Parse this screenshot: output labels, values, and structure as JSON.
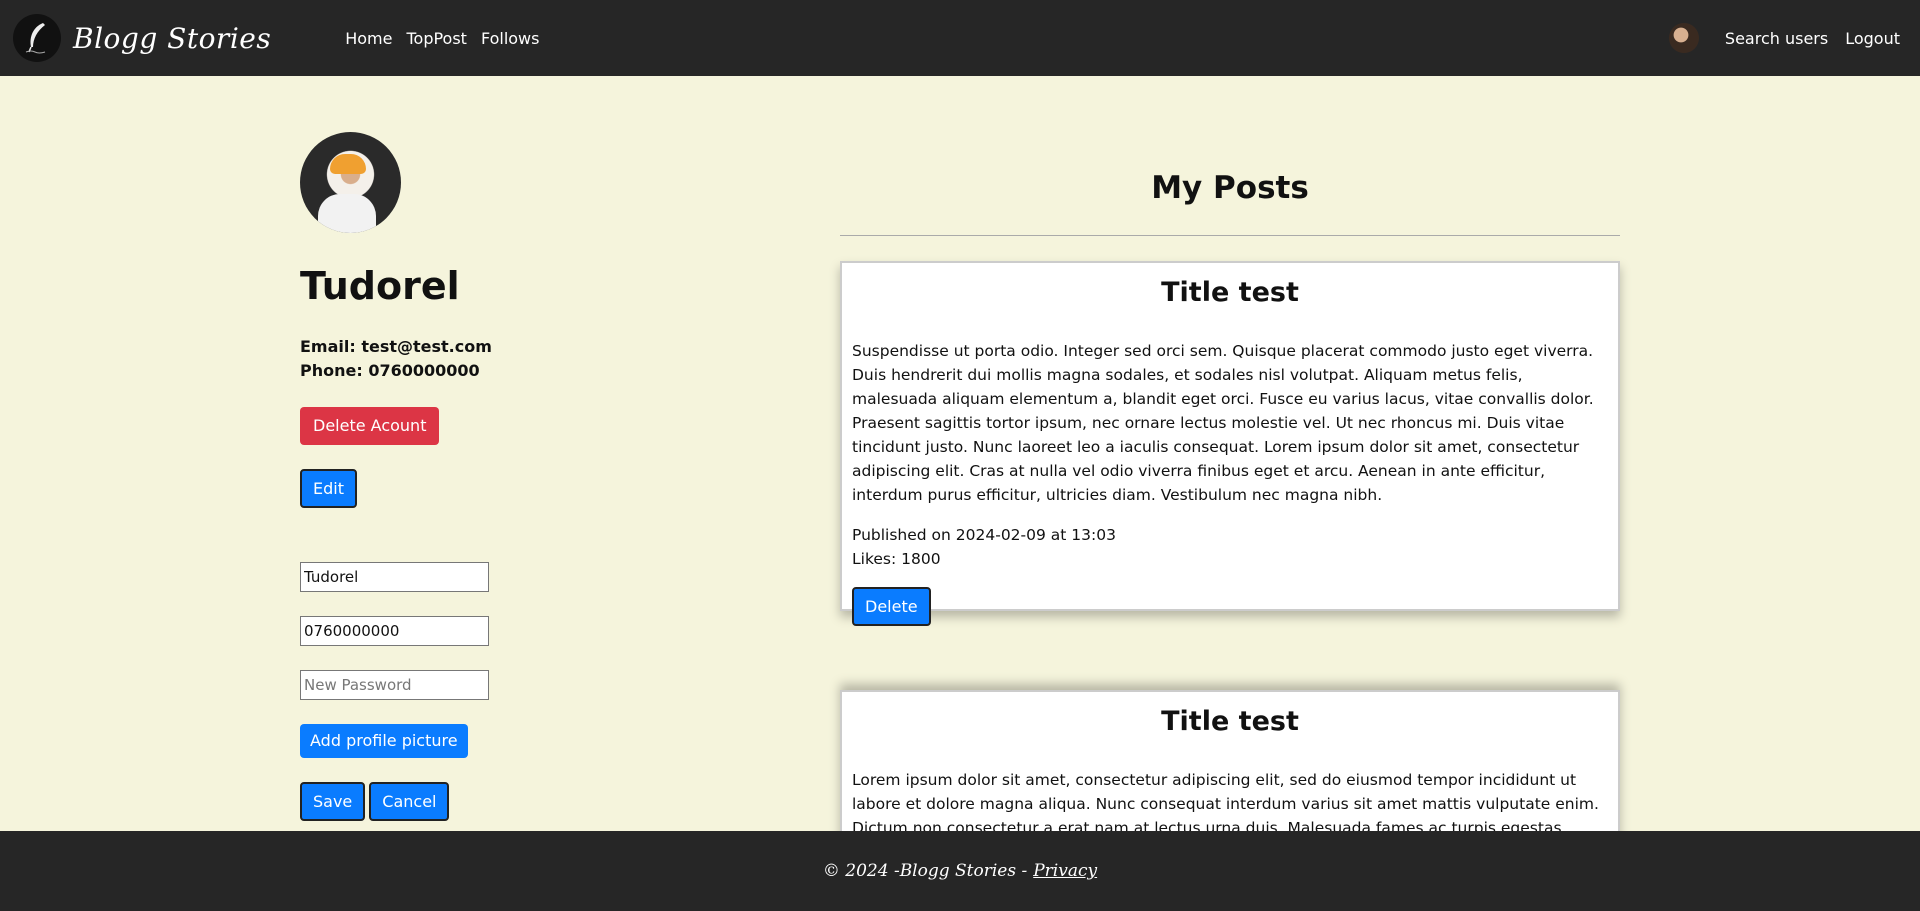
{
  "nav": {
    "brand": "Blogg Stories",
    "links": [
      "Home",
      "TopPost",
      "Follows"
    ],
    "search_users": "Search users",
    "logout": "Logout",
    "logo_icon": "feather-pen-icon"
  },
  "profile": {
    "name": "Tudorel",
    "email_line": "Email: test@test.com",
    "phone_line": "Phone: 0760000000",
    "delete_account_label": "Delete Acount",
    "edit_label": "Edit",
    "form": {
      "name_value": "Tudorel",
      "phone_value": "0760000000",
      "password_placeholder": "New Password",
      "add_picture_label": "Add profile picture",
      "save_label": "Save",
      "cancel_label": "Cancel"
    }
  },
  "posts": {
    "heading": "My Posts",
    "items": [
      {
        "title": "Title test",
        "body": "Suspendisse ut porta odio. Integer sed orci sem. Quisque placerat commodo justo eget viverra. Duis hendrerit dui mollis magna sodales, et sodales nisl volutpat. Aliquam metus felis, malesuada aliquam elementum a, blandit eget orci. Fusce eu varius lacus, vitae convallis dolor. Praesent sagittis tortor ipsum, nec ornare lectus molestie vel. Ut nec rhoncus mi. Duis vitae tincidunt justo. Nunc laoreet leo a iaculis consequat. Lorem ipsum dolor sit amet, consectetur adipiscing elit. Cras at nulla vel odio viverra finibus eget et arcu. Aenean in ante efficitur, interdum purus efficitur, ultricies diam. Vestibulum nec magna nibh.",
        "published": "Published on 2024-02-09 at 13:03",
        "likes": "Likes: 1800",
        "delete_label": "Delete"
      },
      {
        "title": "Title test",
        "body": "Lorem ipsum dolor sit amet, consectetur adipiscing elit, sed do eiusmod tempor incididunt ut labore et dolore magna aliqua. Nunc consequat interdum varius sit amet mattis vulputate enim. Dictum non consectetur a erat nam at lectus urna duis. Malesuada fames ac turpis egestas maecenas pharetra convallis"
      }
    ]
  },
  "footer": {
    "text": "© 2024 -Blogg Stories -",
    "privacy": "Privacy"
  },
  "colors": {
    "page_bg": "#f5f4dc",
    "navbar_bg": "#262626",
    "primary": "#0a7cff",
    "danger": "#dc3545"
  }
}
